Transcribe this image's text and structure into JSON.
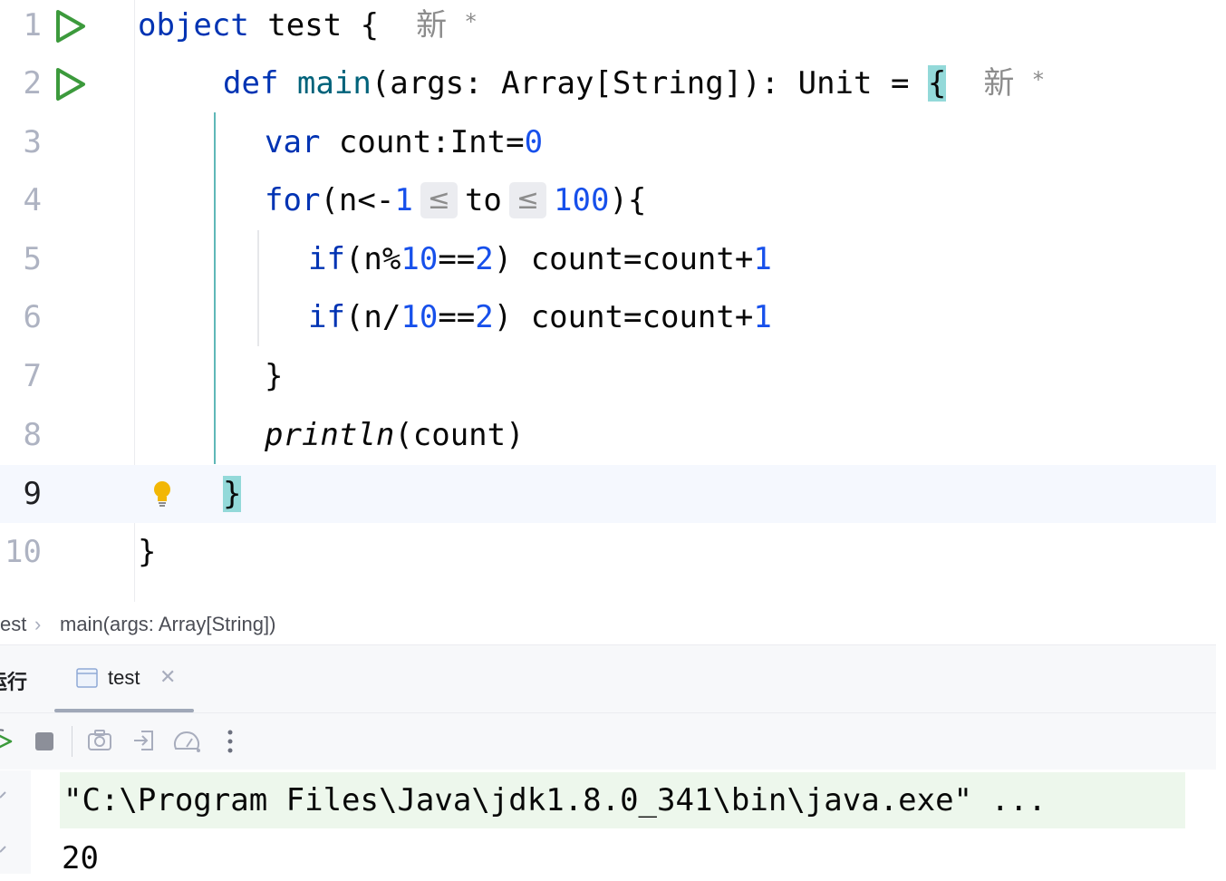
{
  "editor": {
    "line_numbers": [
      "1",
      "2",
      "3",
      "4",
      "5",
      "6",
      "7",
      "8",
      "9",
      "10"
    ],
    "line1": {
      "kw": "object",
      "name": " test {",
      "hint_new": "新",
      "hint_star": "*"
    },
    "line2": {
      "kw": "def",
      "fn": "main",
      "rest": "(args: Array[String]): Unit = ",
      "brace": "{",
      "hint_new": "新",
      "hint_star": "*"
    },
    "line3": {
      "kw": "var",
      "rest": " count:Int=",
      "num": "0"
    },
    "line4": {
      "kw": "for",
      "a": "(n<-",
      "num1": "1",
      "hint1": "≤",
      "to": "to",
      "hint2": "≤",
      "num2": "100",
      "b": "){"
    },
    "line5": {
      "kw": "if",
      "a": "(n%",
      "n1": "10",
      "eq": "==",
      "n2": "2",
      "b": ") count=count+",
      "n3": "1"
    },
    "line6": {
      "kw": "if",
      "a": "(n/",
      "n1": "10",
      "eq": "==",
      "n2": "2",
      "b": ") count=count+",
      "n3": "1"
    },
    "line7": {
      "text": "}"
    },
    "line8": {
      "fn": "println",
      "rest": "(count)"
    },
    "line9": {
      "brace": "}"
    },
    "line10": {
      "text": "}"
    }
  },
  "breadcrumb": {
    "items": [
      "est",
      "main(args: Array[String])"
    ],
    "separator": "›"
  },
  "run_panel": {
    "title": "运行",
    "tab_label": "test",
    "console_command": "\"C:\\Program Files\\Java\\jdk1.8.0_341\\bin\\java.exe\" ...",
    "console_output": "20"
  },
  "icons": {
    "run": "run-gutter-icon",
    "bulb": "lightbulb-icon",
    "rerun": "rerun-icon",
    "stop": "stop-icon",
    "camera": "screenshot-icon",
    "exit": "exit-icon",
    "dashboard": "profiler-icon",
    "more": "more-vertical-icon"
  },
  "colors": {
    "keyword": "#0033b3",
    "number": "#1750eb",
    "function": "#00627a",
    "run_green": "#3c9a3c",
    "brace_highlight": "#93d9d9",
    "console_cmd_bg": "#edf7ec"
  }
}
